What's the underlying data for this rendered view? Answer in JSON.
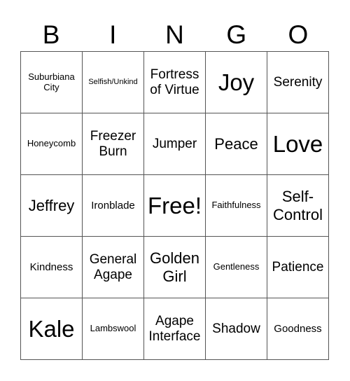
{
  "header": [
    "B",
    "I",
    "N",
    "G",
    "O"
  ],
  "cells": [
    {
      "text": "Suburbiana City",
      "size": "s-s"
    },
    {
      "text": "Selfish/Unkind",
      "size": "s-xs"
    },
    {
      "text": "Fortress of Virtue",
      "size": "s-ml"
    },
    {
      "text": "Joy",
      "size": "s-xl"
    },
    {
      "text": "Serenity",
      "size": "s-ml"
    },
    {
      "text": "Honeycomb",
      "size": "s-s"
    },
    {
      "text": "Freezer Burn",
      "size": "s-ml"
    },
    {
      "text": "Jumper",
      "size": "s-ml"
    },
    {
      "text": "Peace",
      "size": "s-l"
    },
    {
      "text": "Love",
      "size": "s-xl"
    },
    {
      "text": "Jeffrey",
      "size": "s-l"
    },
    {
      "text": "Ironblade",
      "size": "s-m"
    },
    {
      "text": "Free!",
      "size": "s-xl"
    },
    {
      "text": "Faithfulness",
      "size": "s-s"
    },
    {
      "text": "Self-Control",
      "size": "s-l"
    },
    {
      "text": "Kindness",
      "size": "s-m"
    },
    {
      "text": "General Agape",
      "size": "s-ml"
    },
    {
      "text": "Golden Girl",
      "size": "s-l"
    },
    {
      "text": "Gentleness",
      "size": "s-s"
    },
    {
      "text": "Patience",
      "size": "s-ml"
    },
    {
      "text": "Kale",
      "size": "s-xl"
    },
    {
      "text": "Lambswool",
      "size": "s-s"
    },
    {
      "text": "Agape Interface",
      "size": "s-ml"
    },
    {
      "text": "Shadow",
      "size": "s-ml"
    },
    {
      "text": "Goodness",
      "size": "s-m"
    }
  ]
}
